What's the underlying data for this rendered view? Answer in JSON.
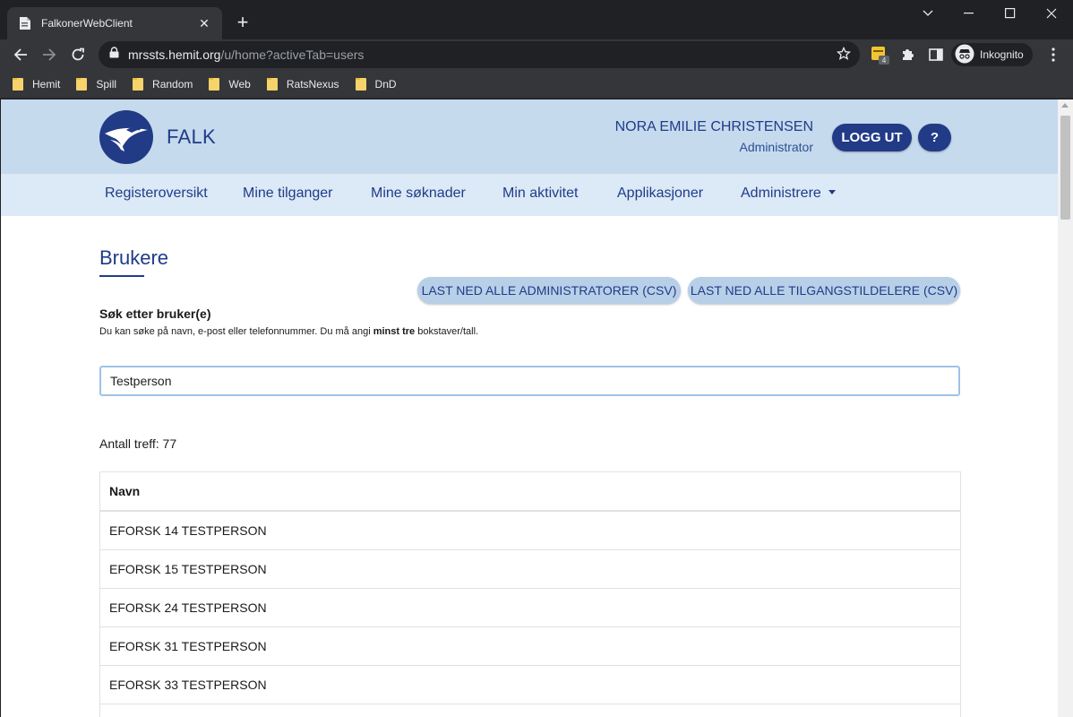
{
  "browser": {
    "tab_title": "FalkonerWebClient",
    "url_host": "mrssts.hemit.org",
    "url_path": "/u/home?activeTab=users",
    "profile_label": "Inkognito",
    "extension_badge": "4",
    "bookmarks": [
      "Hemit",
      "Spill",
      "Random",
      "Web",
      "RatsNexus",
      "DnD"
    ]
  },
  "header": {
    "brand": "FALK",
    "user_name": "NORA EMILIE CHRISTENSEN",
    "user_role": "Administrator",
    "logout_label": "LOGG UT",
    "help_label": "?"
  },
  "nav": {
    "items": [
      "Registeroversikt",
      "Mine tilganger",
      "Mine søknader",
      "Min aktivitet",
      "Applikasjoner",
      "Administrere"
    ]
  },
  "main": {
    "title": "Brukere",
    "download_admins": "LAST NED ALLE ADMINISTRATORER (CSV)",
    "download_grantors": "LAST NED ALLE TILGANGSTILDELERE (CSV)",
    "search_label": "Søk etter bruker(e)",
    "search_help_pre": "Du kan søke på navn, e-post eller telefonnummer. Du må angi ",
    "search_help_bold": "minst tre",
    "search_help_post": " bokstaver/tall.",
    "search_value": "Testperson",
    "hits": "Antall treff: 77",
    "table_header": "Navn",
    "rows": [
      "EFORSK 14 TESTPERSON",
      "EFORSK 15 TESTPERSON",
      "EFORSK 24 TESTPERSON",
      "EFORSK 31 TESTPERSON",
      "EFORSK 33 TESTPERSON"
    ]
  },
  "colors": {
    "brand_blue": "#1f3c88",
    "header_bg": "#c6daee",
    "nav_bg": "#dce9f6",
    "button_light": "#b8cfe8"
  }
}
